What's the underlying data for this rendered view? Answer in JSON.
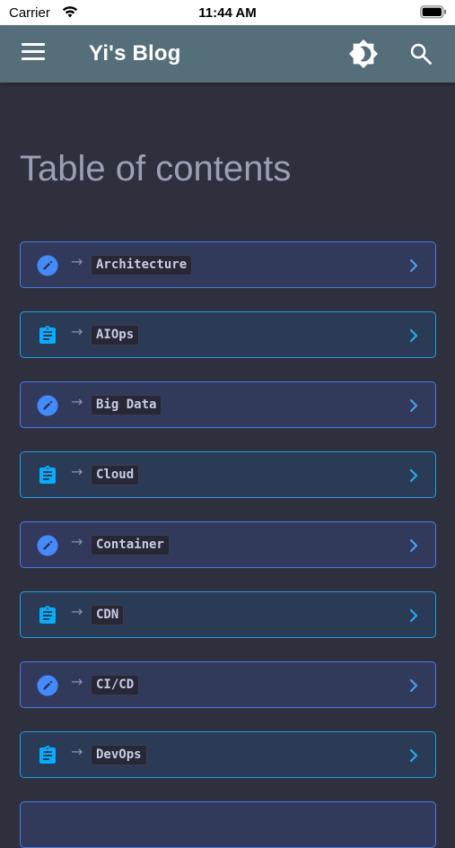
{
  "status_bar": {
    "carrier": "Carrier",
    "time": "11:44 AM",
    "icons": [
      "wifi-icon",
      "battery-icon"
    ]
  },
  "app_bar": {
    "title": "Yi's Blog",
    "background": "#546e7a",
    "icons": [
      "menu-icon",
      "brightness-icon",
      "search-icon"
    ]
  },
  "page": {
    "title": "Table of contents",
    "background": "#2e303e"
  },
  "toc": {
    "arrow": "→",
    "items": [
      {
        "label": "Architecture",
        "icon": "pencil-icon",
        "accent": "#4a78e8"
      },
      {
        "label": "AIOps",
        "icon": "clipboard-icon",
        "accent": "#1e9fe0"
      },
      {
        "label": "Big Data",
        "icon": "pencil-icon",
        "accent": "#4a78e8"
      },
      {
        "label": "Cloud",
        "icon": "clipboard-icon",
        "accent": "#1e9fe0"
      },
      {
        "label": "Container",
        "icon": "pencil-icon",
        "accent": "#4a78e8"
      },
      {
        "label": "CDN",
        "icon": "clipboard-icon",
        "accent": "#1e9fe0"
      },
      {
        "label": "CI/CD",
        "icon": "pencil-icon",
        "accent": "#4a78e8"
      },
      {
        "label": "DevOps",
        "icon": "clipboard-icon",
        "accent": "#1e9fe0"
      },
      {
        "label": "",
        "icon": "pencil-icon",
        "accent": "#4a78e8"
      }
    ]
  }
}
